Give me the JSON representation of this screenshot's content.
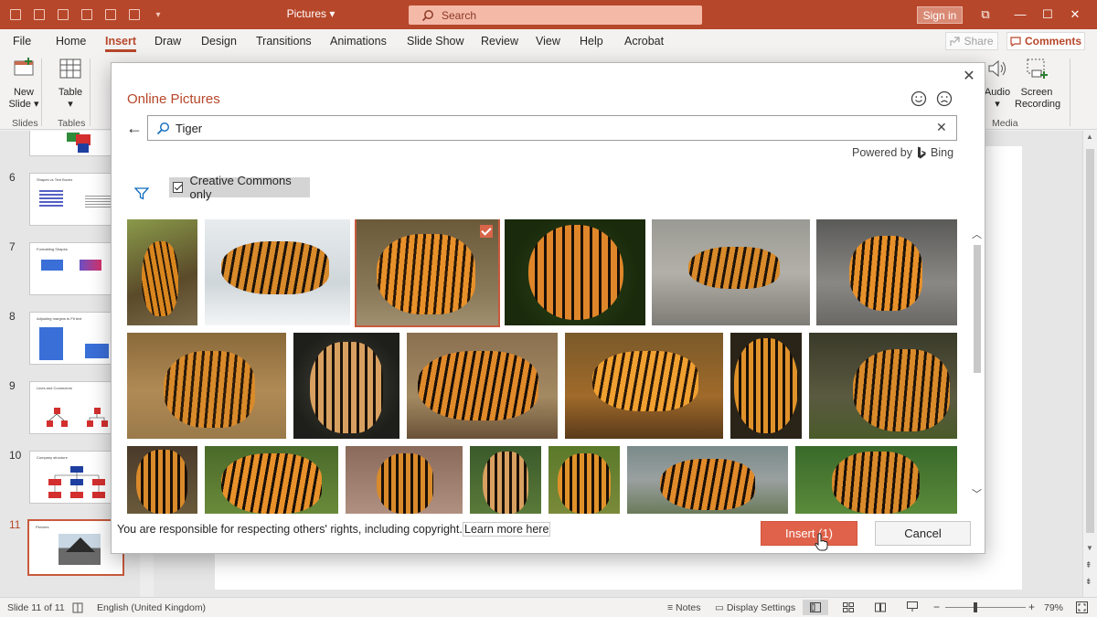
{
  "window": {
    "doc_title": "Pictures",
    "search_placeholder": "Search",
    "sign_in": "Sign in"
  },
  "tabs": [
    "File",
    "Home",
    "Insert",
    "Draw",
    "Design",
    "Transitions",
    "Animations",
    "Slide Show",
    "Review",
    "View",
    "Help",
    "Acrobat"
  ],
  "active_tab": "Insert",
  "share_label": "Share",
  "comments_label": "Comments",
  "ribbon": {
    "new_slide": "New\nSlide",
    "table": "Table",
    "audio": "Audio",
    "screen_recording": "Screen\nRecording",
    "groups": {
      "slides": "Slides",
      "tables": "Tables",
      "media": "Media"
    }
  },
  "slides": [
    {
      "num": "6",
      "title": "Shapes vs Text Boxes"
    },
    {
      "num": "7",
      "title": "Formatting Shapes"
    },
    {
      "num": "8",
      "title": "Adjusting margins to Fit text"
    },
    {
      "num": "9",
      "title": "Lines and Connectors"
    },
    {
      "num": "10",
      "title": "Company structure"
    },
    {
      "num": "11",
      "title": "Pictures"
    }
  ],
  "dialog": {
    "title": "Online Pictures",
    "search_value": "Tiger",
    "powered_by": "Powered by",
    "bing": "Bing",
    "creative_commons": "Creative Commons only",
    "footer_text": "You are responsible for respecting others' rights, including copyright.",
    "learn_more": "Learn more here",
    "insert_label": "Insert (1)",
    "cancel_label": "Cancel"
  },
  "status": {
    "slide_info": "Slide 11 of 11",
    "language": "English (United Kingdom)",
    "notes": "Notes",
    "display_settings": "Display Settings",
    "zoom": "79%"
  },
  "colors": {
    "accent": "#b7472a",
    "insert_button": "#e0624a"
  }
}
